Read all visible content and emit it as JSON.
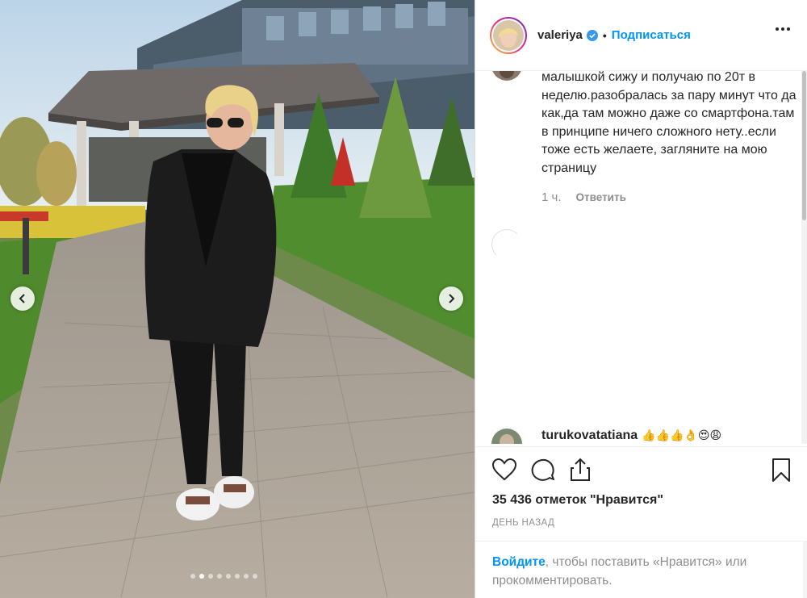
{
  "post": {
    "username": "valeriya",
    "separator": "•",
    "follow_label": "Подписаться",
    "more_icon": "more-horizontal-icon",
    "verified_icon": "verified-badge-icon"
  },
  "photo": {
    "prev_icon": "chevron-left-icon",
    "next_icon": "chevron-right-icon",
    "dots_total": 8,
    "dots_active": 2
  },
  "comments": [
    {
      "text": "малышкой сижу и получаю по 20т в неделю.разобралась за пару минут что да как,да там можно даже со смартфона.там в принципе ничего сложного нету..если тоже есть желаете, загляните на мою страницу",
      "time": "1 ч.",
      "reply_label": "Ответить"
    },
    {
      "username": "turukovatatiana",
      "text": "👍👍👍👌😍😩"
    }
  ],
  "actions": {
    "like_icon": "heart-icon",
    "comment_icon": "comment-icon",
    "share_icon": "share-icon",
    "save_icon": "bookmark-icon",
    "likes_text": "35 436 отметок \"Нравится\"",
    "date_text": "День назад"
  },
  "login_prompt": {
    "link_text": "Войдите",
    "rest_text": ", чтобы поставить «Нравится» или прокомментировать."
  },
  "colors": {
    "accent": "#0095f6",
    "text": "#262626",
    "muted": "#8e8e8e"
  }
}
